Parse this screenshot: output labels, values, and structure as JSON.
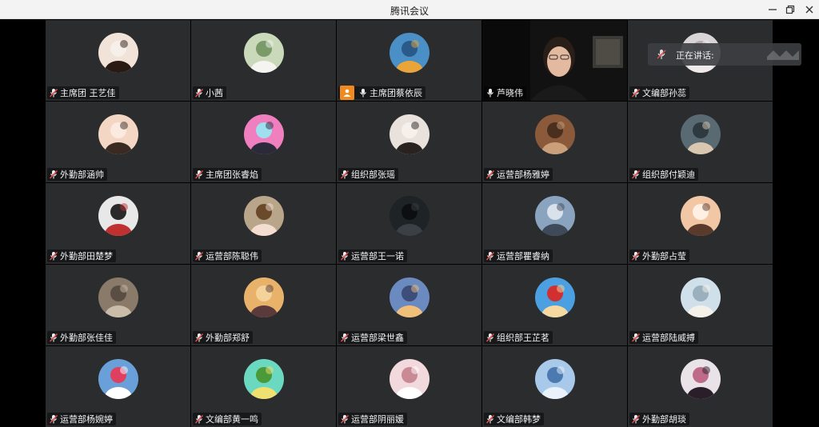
{
  "window": {
    "title": "腾讯会议"
  },
  "speaking_indicator": {
    "label": "正在讲话:"
  },
  "participants": [
    {
      "name": "主席团 王艺佳",
      "avatar": "portrait-girl-white",
      "mic": "muted"
    },
    {
      "name": "小茜",
      "avatar": "white-flowers",
      "mic": "muted"
    },
    {
      "name": "主席团蔡依辰",
      "avatar": "blue-cartoon-monster",
      "mic": "active",
      "host": true
    },
    {
      "name": "芦晓伟",
      "avatar": "webcam-video",
      "mic": "active",
      "video": true
    },
    {
      "name": "文编部孙蕊",
      "avatar": "pale-portrait",
      "mic": "muted"
    },
    {
      "name": "外勤部涵帅",
      "avatar": "child-face",
      "mic": "muted"
    },
    {
      "name": "主席团张睿焰",
      "avatar": "anime-boy-glasses",
      "mic": "muted"
    },
    {
      "name": "组织部张瑶",
      "avatar": "girl-with-cat",
      "mic": "muted"
    },
    {
      "name": "运营部杨雅婷",
      "avatar": "vintage-photo",
      "mic": "muted"
    },
    {
      "name": "组织部付颖迪",
      "avatar": "boy-with-dog",
      "mic": "muted"
    },
    {
      "name": "外勤部田楚梦",
      "avatar": "girl-hat-red",
      "mic": "muted"
    },
    {
      "name": "运营部陈聪伟",
      "avatar": "curly-girl-glasses",
      "mic": "muted"
    },
    {
      "name": "运营部王一诺",
      "avatar": "dark-figure",
      "mic": "muted"
    },
    {
      "name": "运营部瞿睿纳",
      "avatar": "river-bridge",
      "mic": "muted"
    },
    {
      "name": "外勤部占莹",
      "avatar": "smiling-girl",
      "mic": "muted"
    },
    {
      "name": "外勤部张佳佳",
      "avatar": "cat-sketch",
      "mic": "muted"
    },
    {
      "name": "外勤部郑舒",
      "avatar": "sunset-couple",
      "mic": "muted"
    },
    {
      "name": "运营部梁世鑫",
      "avatar": "cloud-sea",
      "mic": "muted"
    },
    {
      "name": "组织部王芷茗",
      "avatar": "cartoon-boy-red",
      "mic": "muted"
    },
    {
      "name": "运营部陆威搏",
      "avatar": "alpaca",
      "mic": "muted"
    },
    {
      "name": "运营部杨婉婷",
      "avatar": "hello-kitty",
      "mic": "muted"
    },
    {
      "name": "文编部黄一鸣",
      "avatar": "green-cartoon",
      "mic": "muted"
    },
    {
      "name": "运营部阴丽媛",
      "avatar": "pink-bunny",
      "mic": "muted"
    },
    {
      "name": "文编部韩梦",
      "avatar": "blue-water",
      "mic": "muted"
    },
    {
      "name": "外勤部胡琰",
      "avatar": "anime-girl-dark",
      "mic": "muted"
    }
  ],
  "colors": {
    "tile": "#2b2c2e",
    "host_badge": "#f08a1e",
    "muted_mic": "#e04b4b"
  }
}
